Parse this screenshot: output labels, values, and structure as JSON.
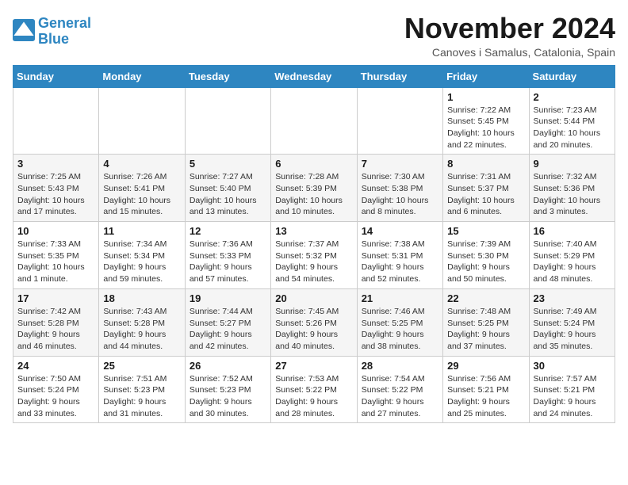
{
  "logo": {
    "line1": "General",
    "line2": "Blue"
  },
  "title": "November 2024",
  "subtitle": "Canoves i Samalus, Catalonia, Spain",
  "weekdays": [
    "Sunday",
    "Monday",
    "Tuesday",
    "Wednesday",
    "Thursday",
    "Friday",
    "Saturday"
  ],
  "weeks": [
    [
      {
        "day": "",
        "info": ""
      },
      {
        "day": "",
        "info": ""
      },
      {
        "day": "",
        "info": ""
      },
      {
        "day": "",
        "info": ""
      },
      {
        "day": "",
        "info": ""
      },
      {
        "day": "1",
        "info": "Sunrise: 7:22 AM\nSunset: 5:45 PM\nDaylight: 10 hours and 22 minutes."
      },
      {
        "day": "2",
        "info": "Sunrise: 7:23 AM\nSunset: 5:44 PM\nDaylight: 10 hours and 20 minutes."
      }
    ],
    [
      {
        "day": "3",
        "info": "Sunrise: 7:25 AM\nSunset: 5:43 PM\nDaylight: 10 hours and 17 minutes."
      },
      {
        "day": "4",
        "info": "Sunrise: 7:26 AM\nSunset: 5:41 PM\nDaylight: 10 hours and 15 minutes."
      },
      {
        "day": "5",
        "info": "Sunrise: 7:27 AM\nSunset: 5:40 PM\nDaylight: 10 hours and 13 minutes."
      },
      {
        "day": "6",
        "info": "Sunrise: 7:28 AM\nSunset: 5:39 PM\nDaylight: 10 hours and 10 minutes."
      },
      {
        "day": "7",
        "info": "Sunrise: 7:30 AM\nSunset: 5:38 PM\nDaylight: 10 hours and 8 minutes."
      },
      {
        "day": "8",
        "info": "Sunrise: 7:31 AM\nSunset: 5:37 PM\nDaylight: 10 hours and 6 minutes."
      },
      {
        "day": "9",
        "info": "Sunrise: 7:32 AM\nSunset: 5:36 PM\nDaylight: 10 hours and 3 minutes."
      }
    ],
    [
      {
        "day": "10",
        "info": "Sunrise: 7:33 AM\nSunset: 5:35 PM\nDaylight: 10 hours and 1 minute."
      },
      {
        "day": "11",
        "info": "Sunrise: 7:34 AM\nSunset: 5:34 PM\nDaylight: 9 hours and 59 minutes."
      },
      {
        "day": "12",
        "info": "Sunrise: 7:36 AM\nSunset: 5:33 PM\nDaylight: 9 hours and 57 minutes."
      },
      {
        "day": "13",
        "info": "Sunrise: 7:37 AM\nSunset: 5:32 PM\nDaylight: 9 hours and 54 minutes."
      },
      {
        "day": "14",
        "info": "Sunrise: 7:38 AM\nSunset: 5:31 PM\nDaylight: 9 hours and 52 minutes."
      },
      {
        "day": "15",
        "info": "Sunrise: 7:39 AM\nSunset: 5:30 PM\nDaylight: 9 hours and 50 minutes."
      },
      {
        "day": "16",
        "info": "Sunrise: 7:40 AM\nSunset: 5:29 PM\nDaylight: 9 hours and 48 minutes."
      }
    ],
    [
      {
        "day": "17",
        "info": "Sunrise: 7:42 AM\nSunset: 5:28 PM\nDaylight: 9 hours and 46 minutes."
      },
      {
        "day": "18",
        "info": "Sunrise: 7:43 AM\nSunset: 5:28 PM\nDaylight: 9 hours and 44 minutes."
      },
      {
        "day": "19",
        "info": "Sunrise: 7:44 AM\nSunset: 5:27 PM\nDaylight: 9 hours and 42 minutes."
      },
      {
        "day": "20",
        "info": "Sunrise: 7:45 AM\nSunset: 5:26 PM\nDaylight: 9 hours and 40 minutes."
      },
      {
        "day": "21",
        "info": "Sunrise: 7:46 AM\nSunset: 5:25 PM\nDaylight: 9 hours and 38 minutes."
      },
      {
        "day": "22",
        "info": "Sunrise: 7:48 AM\nSunset: 5:25 PM\nDaylight: 9 hours and 37 minutes."
      },
      {
        "day": "23",
        "info": "Sunrise: 7:49 AM\nSunset: 5:24 PM\nDaylight: 9 hours and 35 minutes."
      }
    ],
    [
      {
        "day": "24",
        "info": "Sunrise: 7:50 AM\nSunset: 5:24 PM\nDaylight: 9 hours and 33 minutes."
      },
      {
        "day": "25",
        "info": "Sunrise: 7:51 AM\nSunset: 5:23 PM\nDaylight: 9 hours and 31 minutes."
      },
      {
        "day": "26",
        "info": "Sunrise: 7:52 AM\nSunset: 5:23 PM\nDaylight: 9 hours and 30 minutes."
      },
      {
        "day": "27",
        "info": "Sunrise: 7:53 AM\nSunset: 5:22 PM\nDaylight: 9 hours and 28 minutes."
      },
      {
        "day": "28",
        "info": "Sunrise: 7:54 AM\nSunset: 5:22 PM\nDaylight: 9 hours and 27 minutes."
      },
      {
        "day": "29",
        "info": "Sunrise: 7:56 AM\nSunset: 5:21 PM\nDaylight: 9 hours and 25 minutes."
      },
      {
        "day": "30",
        "info": "Sunrise: 7:57 AM\nSunset: 5:21 PM\nDaylight: 9 hours and 24 minutes."
      }
    ]
  ]
}
